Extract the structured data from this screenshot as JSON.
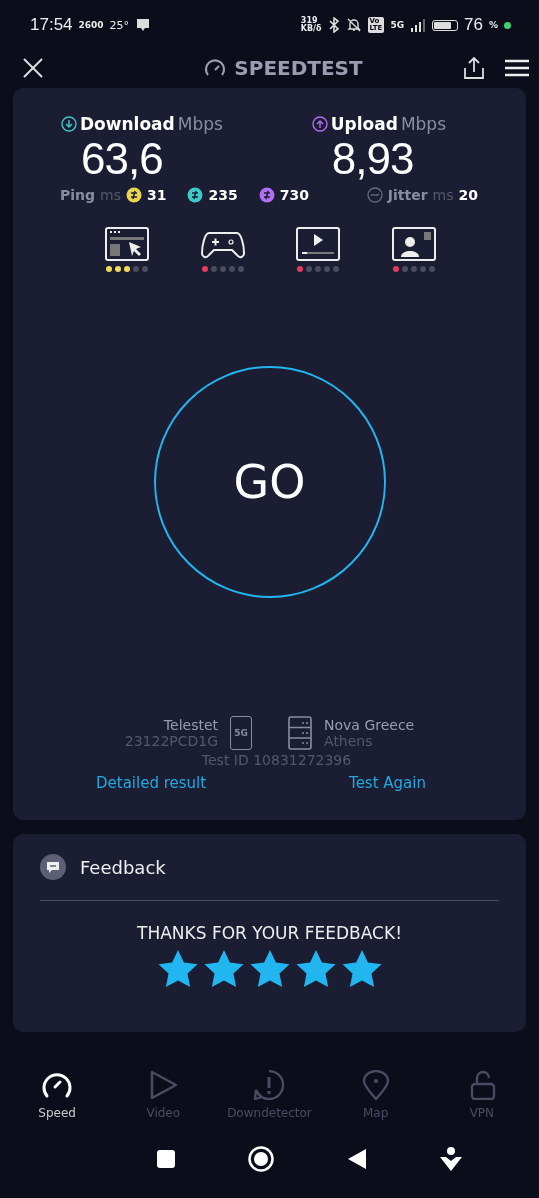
{
  "status_bar": {
    "time": "17:54",
    "hotspot": "2600",
    "temperature": "25°",
    "net_speed": "319",
    "net_unit": "KB/δ",
    "volte_top": "Vo",
    "volte_bottom": "LTE",
    "network": "5G",
    "battery": "76",
    "battery_unit": "%"
  },
  "header": {
    "title": "SPEEDTEST"
  },
  "results": {
    "download": {
      "label": "Download",
      "unit": "Mbps",
      "value": "63,6"
    },
    "upload": {
      "label": "Upload",
      "unit": "Mbps",
      "value": "8,93"
    },
    "ping": {
      "label": "Ping",
      "unit": "ms",
      "values": [
        {
          "value": "31",
          "color": "#e8d44d"
        },
        {
          "value": "235",
          "color": "#3ec9c9"
        },
        {
          "value": "730",
          "color": "#b06ef0"
        }
      ]
    },
    "jitter": {
      "label": "Jitter",
      "unit": "ms",
      "value": "20"
    },
    "quality": [
      {
        "kind": "browsing",
        "level": 0.6,
        "color": "#f0dc5a"
      },
      {
        "kind": "gaming",
        "level": 0.2,
        "color": "#e83a5e"
      },
      {
        "kind": "streaming",
        "level": 0.2,
        "color": "#e83a5e"
      },
      {
        "kind": "video_call",
        "level": 0.2,
        "color": "#e83a5e"
      }
    ],
    "go": "GO",
    "provider": {
      "name": "Telestet",
      "device": "23122PCD1G",
      "network": "5G"
    },
    "server": {
      "name": "Nova Greece",
      "city": "Athens"
    },
    "test_id": "Test ID 10831272396",
    "links": [
      "Detailed result",
      "Test Again"
    ]
  },
  "feedback": {
    "title": "Feedback",
    "message": "THANKS FOR YOUR FEEDBACK!",
    "stars": 5
  },
  "nav": [
    {
      "kind": "speed",
      "label": "Speed",
      "selected": true
    },
    {
      "kind": "video",
      "label": "Video",
      "selected": false
    },
    {
      "kind": "alert",
      "label": "Downdetector",
      "selected": false
    },
    {
      "kind": "map",
      "label": "Map",
      "selected": false
    },
    {
      "kind": "vpn",
      "label": "VPN",
      "selected": false
    }
  ]
}
